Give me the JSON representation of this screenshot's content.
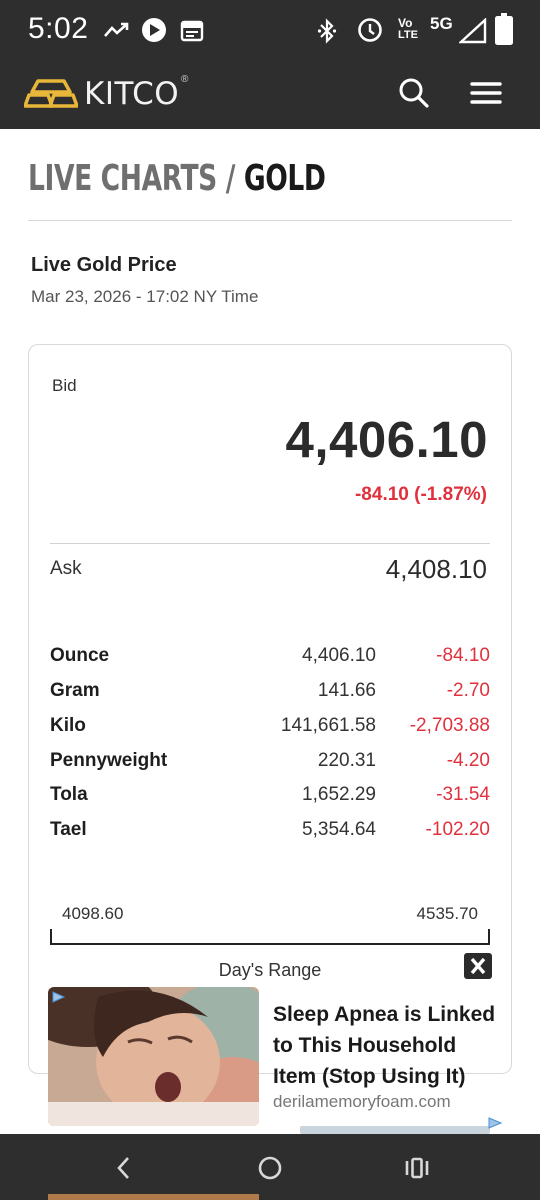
{
  "status_bar": {
    "time": "5:02",
    "network_label": "5G",
    "volte_top": "Vo",
    "volte_bottom": "LTE",
    "icons": [
      "trending-icon",
      "app-notification-icon",
      "calendar-icon",
      "bluetooth-icon",
      "alarm-icon",
      "volte-icon",
      "signal-icon",
      "battery-icon"
    ]
  },
  "header": {
    "logo_text": "KITCO",
    "logo_registered": "®",
    "icons": [
      "search-icon",
      "menu-icon"
    ],
    "brand_color": "#e8b73a"
  },
  "page": {
    "title_part1": "LIVE CHARTS /",
    "title_part2": "GOLD",
    "subtitle": "Live Gold Price",
    "timestamp": "Mar 23, 2026 - 17:02 NY Time"
  },
  "price": {
    "bid_label": "Bid",
    "bid_value": "4,406.10",
    "bid_change": "-84.10 (-1.87%)",
    "ask_label": "Ask",
    "ask_value": "4,408.10",
    "negative_color": "#e0313d"
  },
  "units": [
    {
      "name": "Ounce",
      "price": "4,406.10",
      "change": "-84.10"
    },
    {
      "name": "Gram",
      "price": "141.66",
      "change": "-2.70"
    },
    {
      "name": "Kilo",
      "price": "141,661.58",
      "change": "-2,703.88"
    },
    {
      "name": "Pennyweight",
      "price": "220.31",
      "change": "-4.20"
    },
    {
      "name": "Tola",
      "price": "1,652.29",
      "change": "-31.54"
    },
    {
      "name": "Tael",
      "price": "5,354.64",
      "change": "-102.20"
    }
  ],
  "day_range": {
    "low": "4098.60",
    "high": "4535.70",
    "label": "Day's Range"
  },
  "ad": {
    "headline": "Sleep Apnea is Linked to This Household Item (Stop Using It)",
    "domain": "derilamemoryfoam.com",
    "icons": [
      "ad-choices-icon",
      "close-icon"
    ]
  },
  "nav_bar": {
    "icons": [
      "back-icon",
      "home-icon",
      "recents-icon"
    ]
  }
}
